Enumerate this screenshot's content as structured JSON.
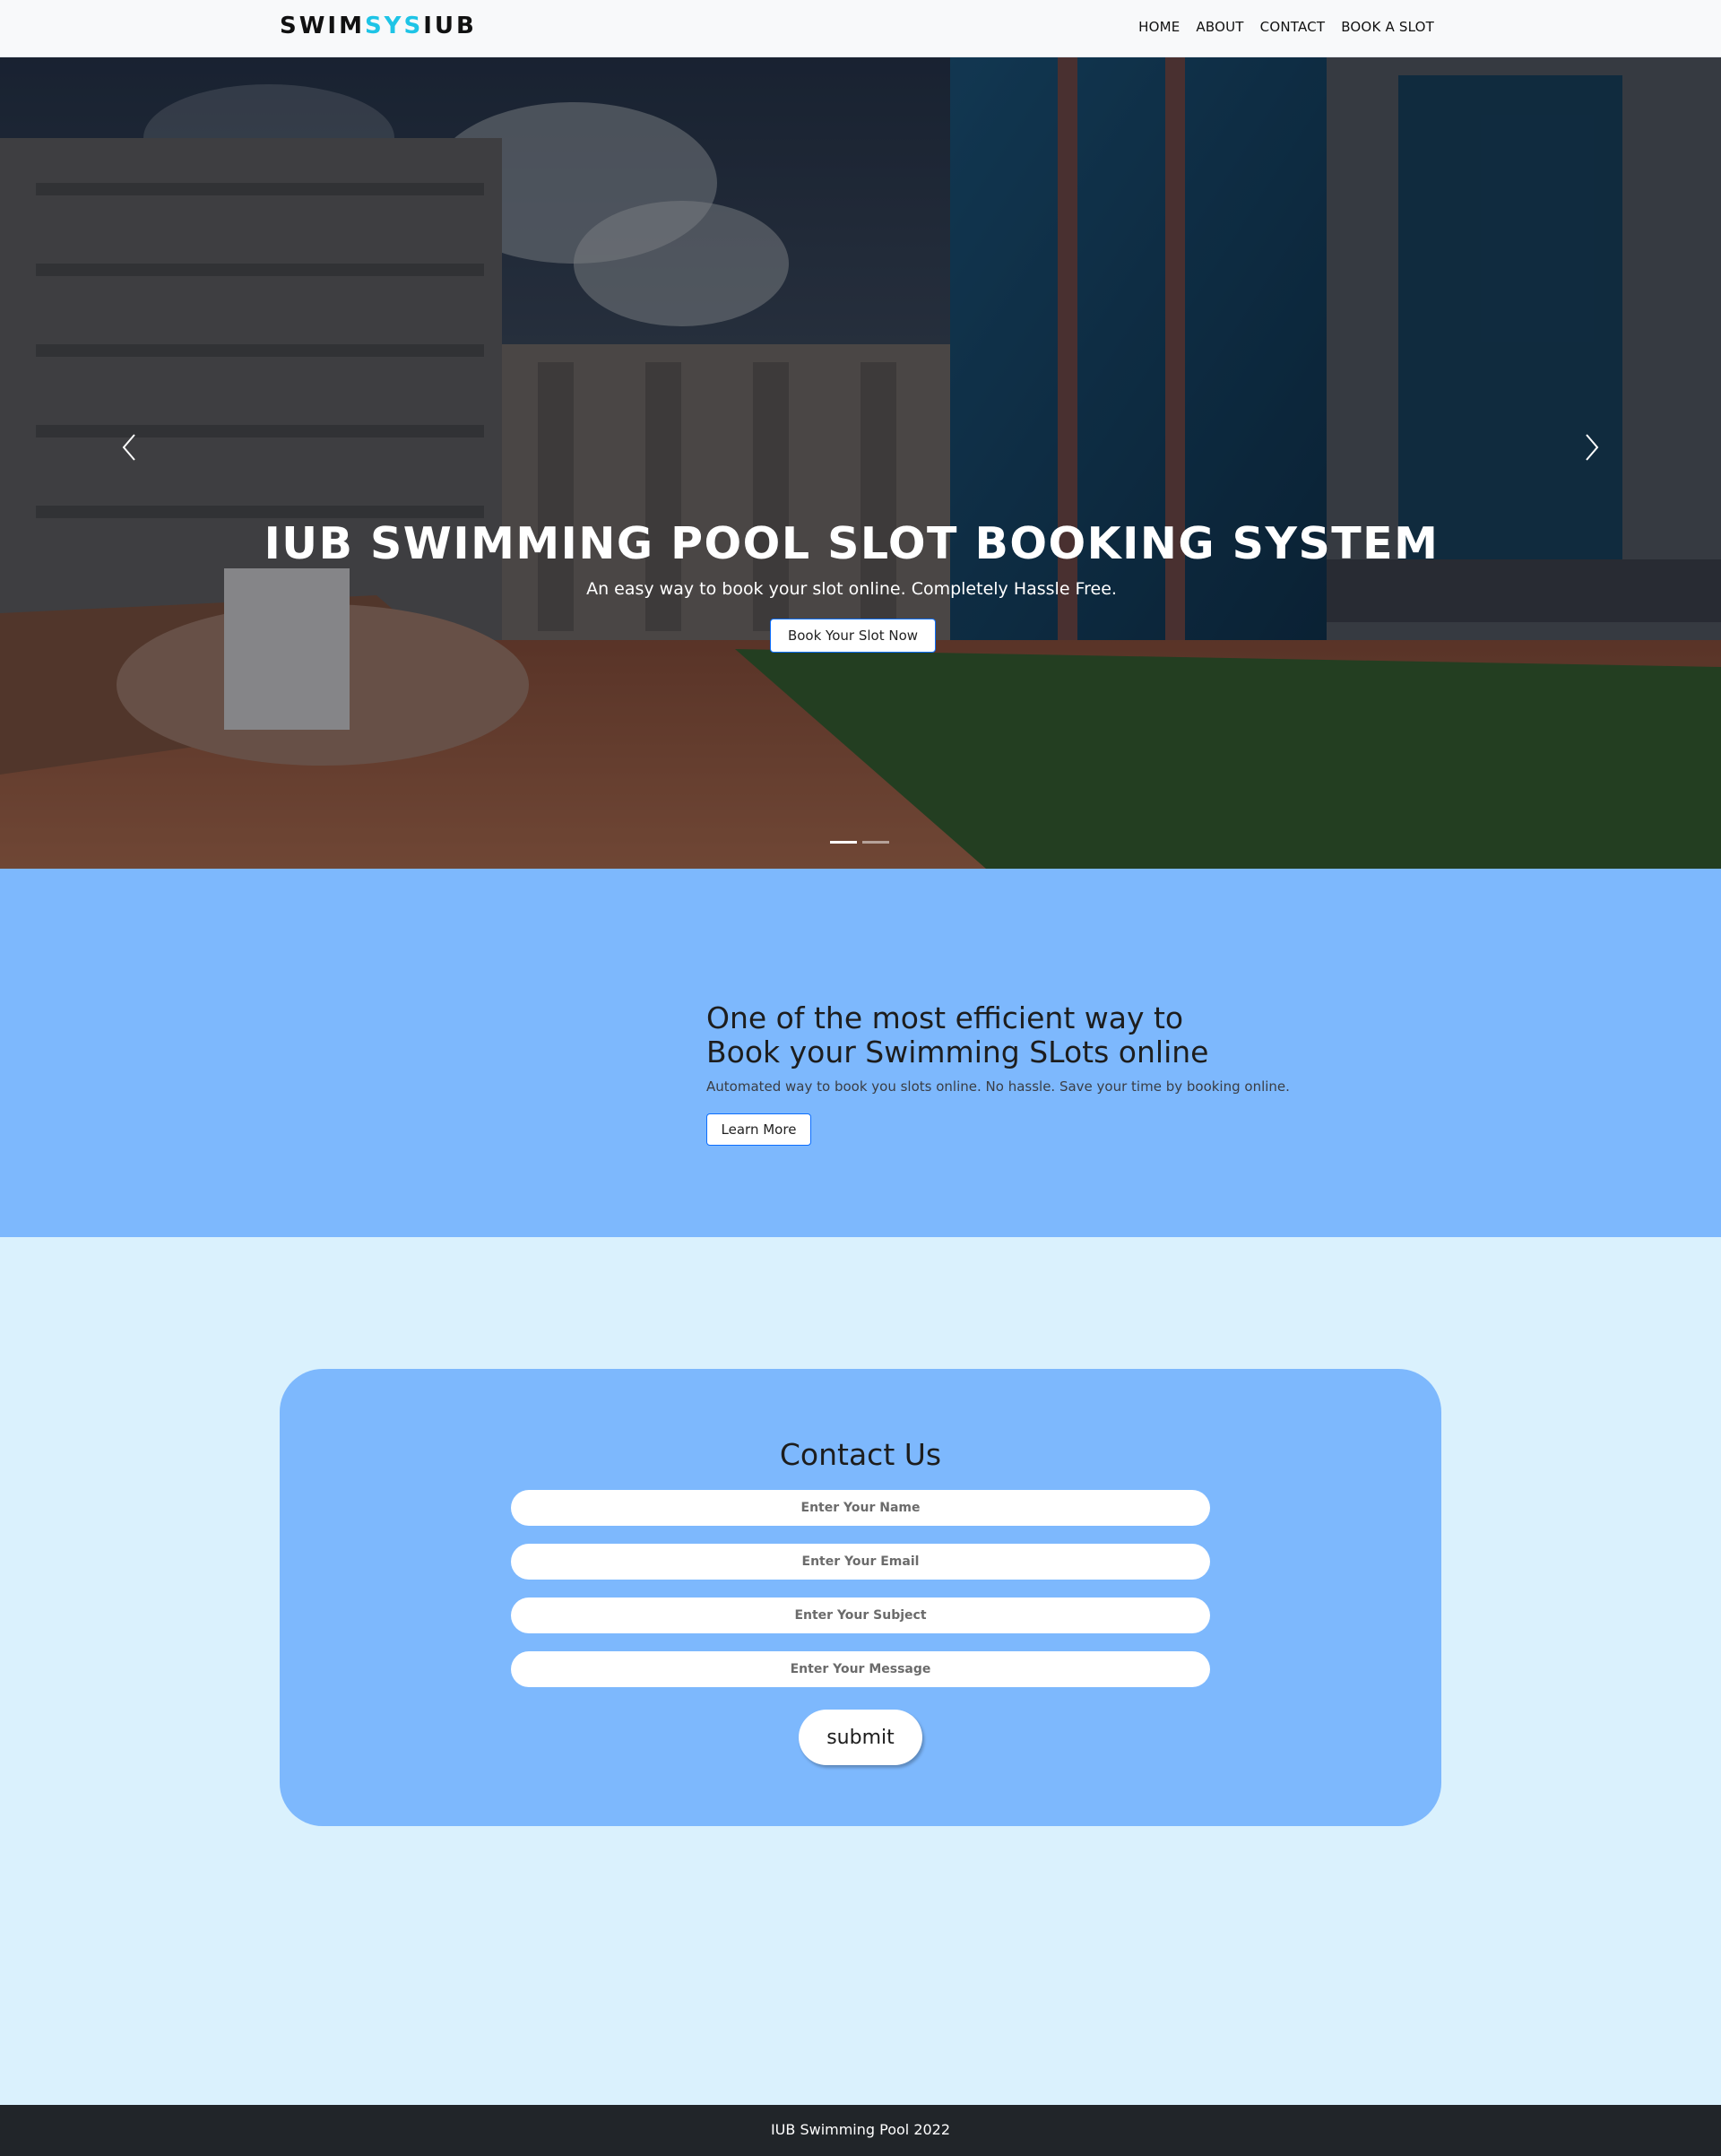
{
  "navbar": {
    "brand_part1": "SWIM",
    "brand_part2": "SYS",
    "brand_part3": "IUB",
    "links": [
      "HOME",
      "ABOUT",
      "CONTACT",
      "BOOK A SLOT"
    ]
  },
  "hero": {
    "title": "IUB SWIMMING POOL SLOT BOOKING SYSTEM",
    "subtitle": "An easy way to book your slot online. Completely Hassle Free.",
    "cta_label": "Book Your Slot Now",
    "slide_count": 2,
    "active_slide": 1
  },
  "about": {
    "heading_line1": "One of the most efficient way to",
    "heading_line2": "Book your Swimming SLots online",
    "text": "Automated way to book you slots online. No hassle. Save your time by booking online.",
    "button_label": "Learn More"
  },
  "contact": {
    "title": "Contact Us",
    "name_placeholder": "Enter Your Name",
    "email_placeholder": "Enter Your Email",
    "subject_placeholder": "Enter Your Subject",
    "message_placeholder": "Enter Your Message",
    "submit_label": "submit"
  },
  "footer": {
    "text": "IUB Swimming Pool 2022"
  },
  "colors": {
    "brand_accent": "#1ec4e6",
    "section_blue": "#7db8fd",
    "page_bg": "#daf1fd",
    "footer_bg": "#212529"
  }
}
